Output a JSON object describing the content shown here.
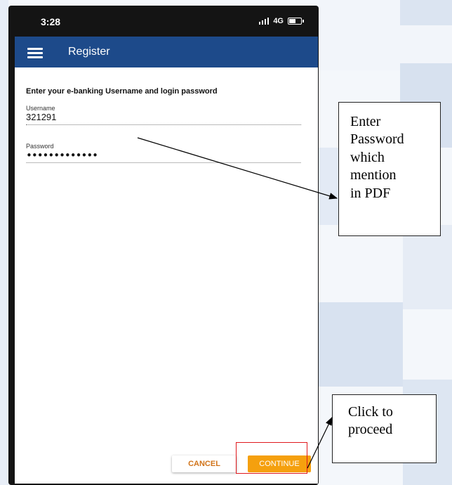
{
  "status_bar": {
    "time": "3:28",
    "network": "4G"
  },
  "app_bar": {
    "title": "Register"
  },
  "form": {
    "instruction": "Enter your e-banking Username and login password",
    "username_label": "Username",
    "username_value": "321291",
    "password_label": "Password",
    "password_value": "•••••••••••••"
  },
  "buttons": {
    "cancel": "CANCEL",
    "continue": "CONTINUE"
  },
  "callouts": {
    "password_lines": [
      "Enter",
      "Password",
      "which",
      "mention",
      "in PDF"
    ],
    "proceed_lines": [
      "Click to",
      "proceed"
    ]
  },
  "colors": {
    "app_bar": "#1d4a8a",
    "continue": "#f5a00e",
    "cancel_text": "#d1741a",
    "highlight": "#e0191d"
  }
}
